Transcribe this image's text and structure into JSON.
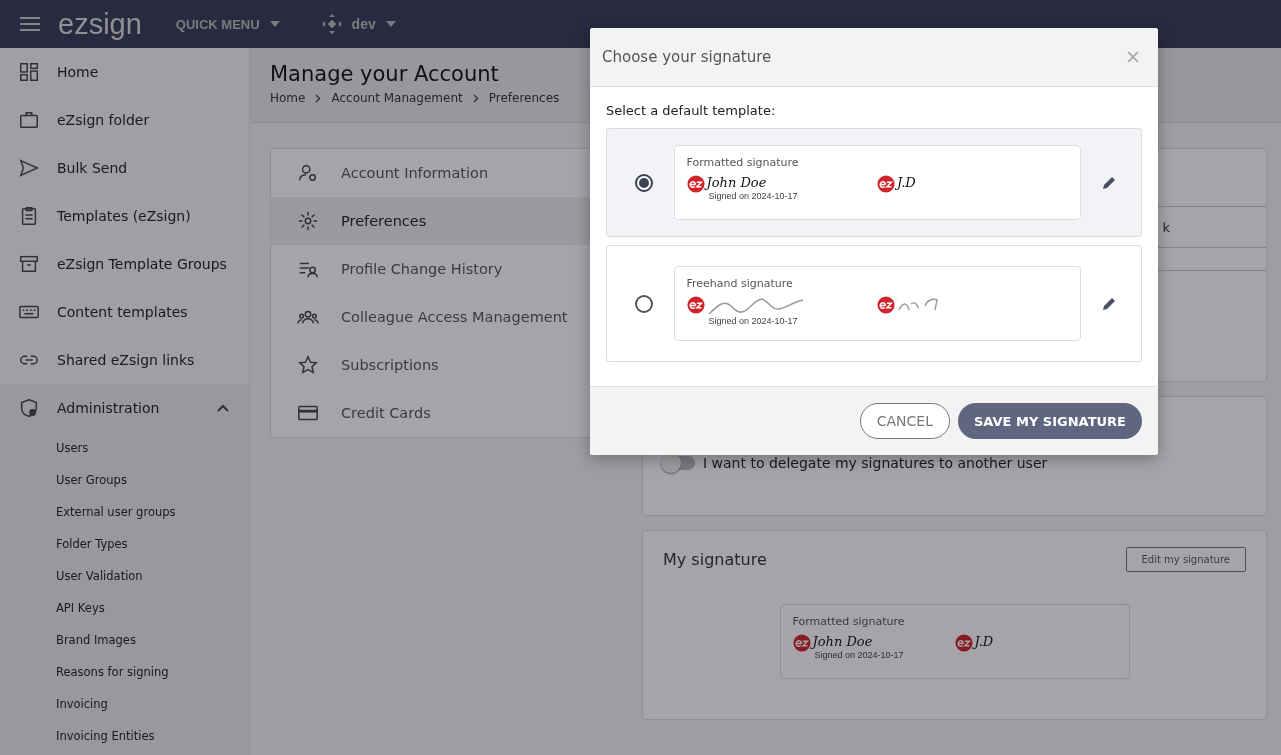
{
  "topbar": {
    "logo": "ezsign",
    "quick_menu": "QUICK MENU",
    "workspace": "dev"
  },
  "sidebar": {
    "items": [
      {
        "label": "Home"
      },
      {
        "label": "eZsign folder"
      },
      {
        "label": "Bulk Send"
      },
      {
        "label": "Templates (eZsign)"
      },
      {
        "label": "eZsign Template Groups"
      },
      {
        "label": "Content templates"
      },
      {
        "label": "Shared eZsign links"
      },
      {
        "label": "Administration",
        "expanded": true,
        "children": [
          {
            "label": "Users"
          },
          {
            "label": "User Groups"
          },
          {
            "label": "External user groups"
          },
          {
            "label": "Folder Types"
          },
          {
            "label": "User Validation"
          },
          {
            "label": "API Keys"
          },
          {
            "label": "Brand Images"
          },
          {
            "label": "Reasons for signing"
          },
          {
            "label": "Invoicing"
          },
          {
            "label": "Invoicing Entities"
          }
        ]
      }
    ]
  },
  "page": {
    "title": "Manage your Account",
    "breadcrumb": [
      "Home",
      "Account Management",
      "Preferences"
    ]
  },
  "settings_menu": [
    {
      "label": "Account Information",
      "selected": false
    },
    {
      "label": "Preferences",
      "selected": true
    },
    {
      "label": "Profile Change History",
      "selected": false
    },
    {
      "label": "Colleague Access Management",
      "selected": false
    },
    {
      "label": "Subscriptions",
      "selected": false
    },
    {
      "label": "Credit Cards",
      "selected": false
    }
  ],
  "preferences": {
    "partial_text": "k",
    "delegate_toggle": {
      "label": "I want to delegate my signatures to another user",
      "on": false
    },
    "my_signature": {
      "title": "My signature",
      "edit_button": "Edit my signature",
      "card": {
        "kind": "formatted",
        "title": "Formatted signature",
        "name": "John Doe",
        "initials": "J.D",
        "date": "Signed on 2024-10-17"
      }
    }
  },
  "dialog": {
    "title": "Choose your signature",
    "close": "×",
    "prompt": "Select a default template:",
    "options": [
      {
        "kind": "formatted",
        "title": "Formatted signature",
        "name": "John Doe",
        "initials": "J.D",
        "date": "Signed on 2024-10-17",
        "selected": true
      },
      {
        "kind": "freehand",
        "title": "Freehand signature",
        "date": "Signed on 2024-10-17",
        "selected": false
      }
    ],
    "buttons": {
      "cancel": "CANCEL",
      "save": "SAVE MY SIGNATURE"
    }
  }
}
